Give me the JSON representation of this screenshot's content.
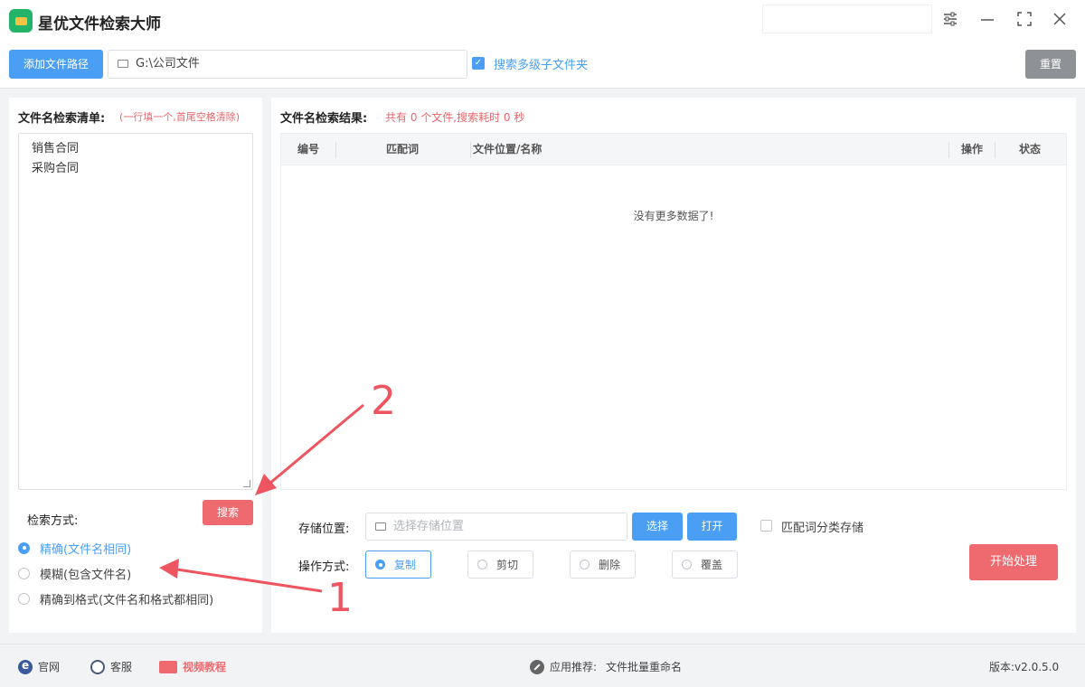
{
  "app": {
    "title": "星优文件检索大师"
  },
  "window": {
    "settings_icon": "sliders-icon",
    "min_icon": "minimize-icon",
    "max_icon": "fullscreen-icon",
    "close_icon": "close-icon"
  },
  "toolbar": {
    "add_path_label": "添加文件路径",
    "path_value": "G:\\公司文件",
    "subfolder_checked": true,
    "subfolder_label": "搜索多级子文件夹",
    "reset_label": "重置"
  },
  "left": {
    "list_title": "文件名检索清单:",
    "list_hint": "(一行填一个,首尾空格清除)",
    "list_items": [
      "销售合同",
      "采购合同"
    ],
    "mode_label": "检索方式:",
    "search_label": "搜索",
    "modes": [
      {
        "label": "精确(文件名相同)",
        "checked": true
      },
      {
        "label": "模糊(包含文件名)",
        "checked": false
      },
      {
        "label": "精确到格式(文件名和格式都相同)",
        "checked": false
      }
    ]
  },
  "right": {
    "results_title": "文件名检索结果:",
    "results_stats": "共有 0 个文件,搜索耗时 0 秒",
    "columns": [
      "编号",
      "匹配词",
      "文件位置/名称",
      "操作",
      "状态"
    ],
    "empty_text": "没有更多数据了!",
    "store_label": "存储位置:",
    "store_placeholder": "选择存储位置",
    "choose_label": "选择",
    "open_label": "打开",
    "classify_label": "匹配词分类存储",
    "op_label": "操作方式:",
    "ops": [
      {
        "label": "复制",
        "checked": true
      },
      {
        "label": "剪切",
        "checked": false
      },
      {
        "label": "删除",
        "checked": false
      },
      {
        "label": "覆盖",
        "checked": false
      }
    ],
    "start_label": "开始处理"
  },
  "annotations": {
    "num1": "1",
    "num2": "2",
    "color": "#ee5560"
  },
  "footer": {
    "website": "官网",
    "service": "客服",
    "video": "视频教程",
    "recommend_label": "应用推荐:",
    "recommend_app": "文件批量重命名",
    "version": "版本:v2.0.5.0"
  }
}
